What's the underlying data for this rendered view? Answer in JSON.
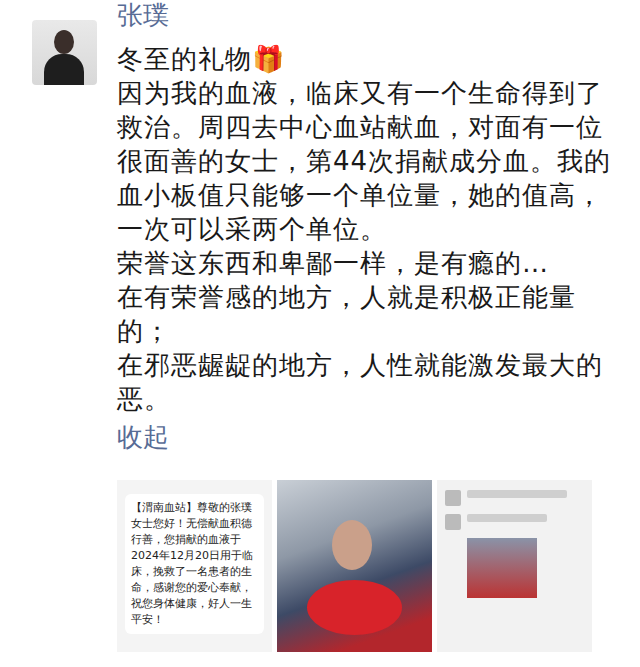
{
  "post": {
    "author": "张璞",
    "lines": [
      "冬至的礼物🎁",
      "因为我的血液，临床又有一个生命得到了",
      "救治。周四去中心血站献血，对面有一位",
      "很面善的女士，第44次捐献成分血。我的",
      "血小板值只能够一个单位量，她的值高，",
      "一次可以采两个单位。",
      "荣誉这东西和卑鄙一样，是有瘾的…",
      "在有荣誉感的地方，人就是积极正能量",
      "的；",
      "在邪恶龌龊的地方，人性就能激发最大的",
      "恶。"
    ],
    "collapse": "收起"
  },
  "images": [
    {
      "kind": "sms",
      "text": "【渭南血站】尊敬的张璞女士您好！无偿献血积德行善，您捐献的血液于2024年12月20日用于临床，挽救了一名患者的生命，感谢您的爱心奉献，祝您身体健康，好人一生平安！"
    },
    {
      "kind": "photo"
    },
    {
      "kind": "screenshot"
    }
  ]
}
